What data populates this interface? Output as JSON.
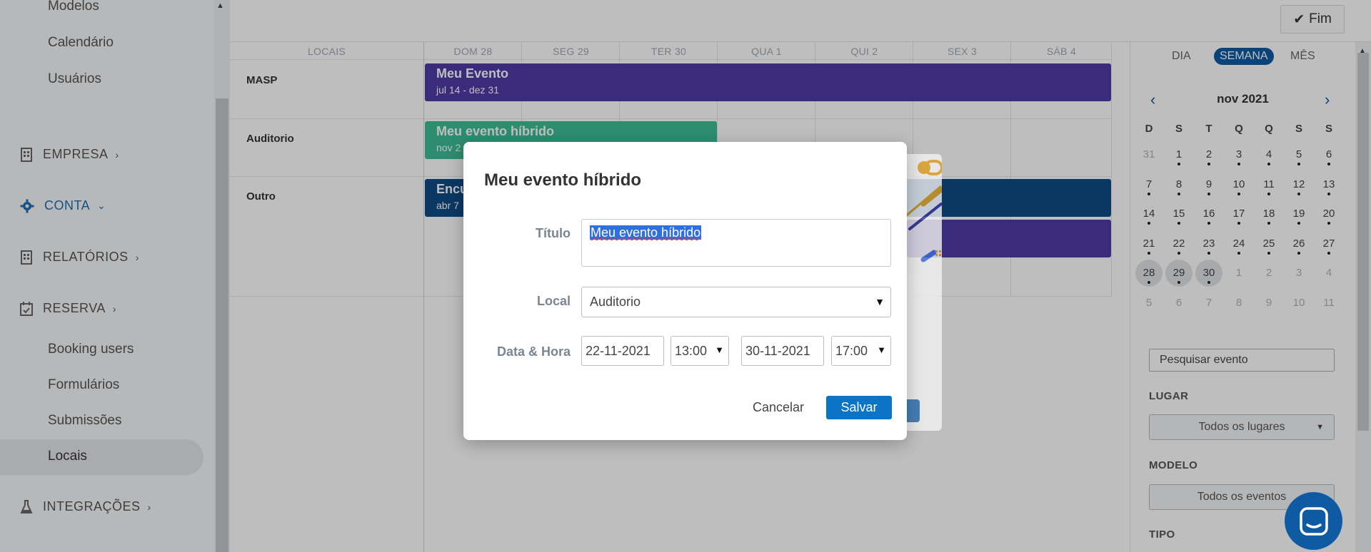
{
  "sidebar": {
    "top_items": [
      "Modelos",
      "Calendário",
      "Usuários"
    ],
    "sections": {
      "empresa": "EMPRESA",
      "conta": "CONTA",
      "relatorios": "RELATÓRIOS",
      "reserva": "RESERVA",
      "integracoes": "INTEGRAÇÕES"
    },
    "reserva_items": [
      "Booking users",
      "Formulários",
      "Submissões",
      "Locais"
    ],
    "active_item": "Locais"
  },
  "topbar": {
    "fim_label": "Fim"
  },
  "calendar": {
    "columns": [
      "LOCAIS",
      "DOM 28",
      "SEG 29",
      "TER 30",
      "QUA 1",
      "QUI 2",
      "SEX 3",
      "SÁB 4"
    ],
    "rows": [
      "MASP",
      "Auditorio",
      "Outro"
    ],
    "events": [
      {
        "title": "Meu Evento",
        "dates": "jul 14 - dez 31",
        "color": "#4e3aa8"
      },
      {
        "title": "Meu evento híbrido",
        "dates": "nov 2",
        "color": "#3dbd96"
      },
      {
        "title": "Encu",
        "dates": "abr 7",
        "color": "#0f4a86"
      },
      {
        "title": "",
        "dates": "",
        "color": "#4e3aa8"
      }
    ]
  },
  "right_panel": {
    "view_tabs": [
      "DIA",
      "SEMANA",
      "MÊS"
    ],
    "active_tab": "SEMANA",
    "month_label": "nov 2021",
    "weekdays": [
      "D",
      "S",
      "T",
      "Q",
      "Q",
      "S",
      "S"
    ],
    "weeks": [
      [
        "31",
        "1",
        "2",
        "3",
        "4",
        "5",
        "6"
      ],
      [
        "7",
        "8",
        "9",
        "10",
        "11",
        "12",
        "13"
      ],
      [
        "14",
        "15",
        "16",
        "17",
        "18",
        "19",
        "20"
      ],
      [
        "21",
        "22",
        "23",
        "24",
        "25",
        "26",
        "27"
      ],
      [
        "28",
        "29",
        "30",
        "1",
        "2",
        "3",
        "4"
      ],
      [
        "5",
        "6",
        "7",
        "8",
        "9",
        "10",
        "11"
      ]
    ],
    "search_placeholder": "Pesquisar evento",
    "lugar_label": "LUGAR",
    "lugar_value": "Todos os lugares",
    "modelo_label": "MODELO",
    "modelo_value": "Todos os eventos",
    "tipo_label": "TIPO"
  },
  "modal": {
    "title": "Meu evento híbrido",
    "titulo_label": "Título",
    "titulo_value": "Meu evento híbrido",
    "local_label": "Local",
    "local_value": "Auditorio",
    "datahora_label": "Data & Hora",
    "start_date": "22-11-2021",
    "start_time": "13:00",
    "end_date": "30-11-2021",
    "end_time": "17:00",
    "cancel_label": "Cancelar",
    "save_label": "Salvar"
  },
  "colors": {
    "accent": "#0b74c7",
    "event_purple": "#4e3aa8",
    "event_teal": "#3dbd96",
    "event_navy": "#0f4a86"
  }
}
